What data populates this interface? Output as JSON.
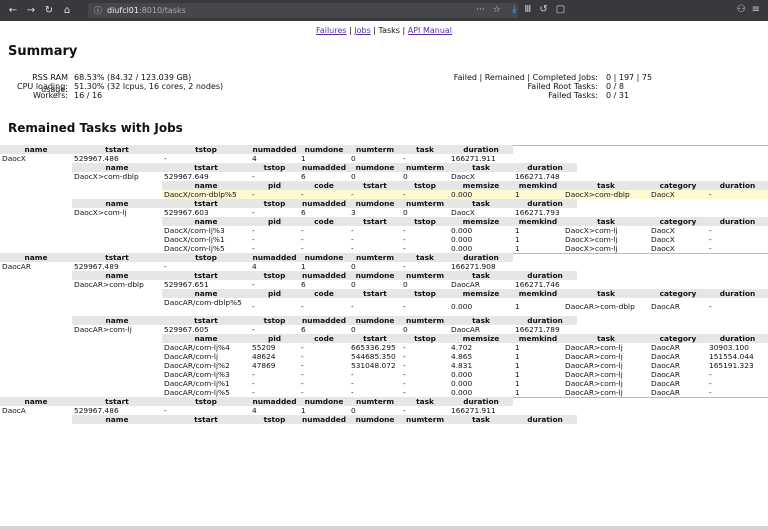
{
  "browser": {
    "host": "diufcl01",
    "path": ":8010/tasks",
    "nav_icons": [
      "←",
      "→",
      "C",
      "⌂"
    ]
  },
  "topnav": {
    "failures": "Failures",
    "jobs": "Jobs",
    "tasks": "Tasks",
    "api": "API Manual",
    "sep": " | "
  },
  "summary": {
    "title": "Summary",
    "left": [
      {
        "k": "RSS RAM usage:",
        "v": "68.53% (84.32 / 123.039 GB)"
      },
      {
        "k": "CPU loading:",
        "v": "51.30% (32 lcpus, 16 cores, 2 nodes)"
      },
      {
        "k": "Workers:",
        "v": "16 / 16"
      }
    ],
    "right": [
      {
        "k": "Failed | Remained | Completed Jobs:",
        "v": "0 | 197 | 75"
      },
      {
        "k": "Failed Root Tasks:",
        "v": "0 / 8"
      },
      {
        "k": "Failed Tasks:",
        "v": "0 / 31"
      }
    ]
  },
  "remained_title": "Remained Tasks with Jobs",
  "headers": {
    "job": [
      "name",
      "tstart",
      "tstop",
      "numadded",
      "numdone",
      "numterm",
      "task",
      "duration"
    ],
    "sub": [
      "name",
      "tstart",
      "tstop",
      "numadded",
      "numdone",
      "numterm",
      "task",
      "duration"
    ],
    "task": [
      "name",
      "pid",
      "code",
      "tstart",
      "tstop",
      "memsize",
      "memkind",
      "task",
      "category",
      "duration"
    ]
  },
  "rows": [
    {
      "t": "jh"
    },
    {
      "t": "jd",
      "v": [
        "DaocX",
        "529967.486",
        "-",
        "4",
        "1",
        "0",
        "-",
        "166271.911"
      ]
    },
    {
      "t": "sh"
    },
    {
      "t": "sd",
      "v": [
        "DaocX>com-dblp",
        "529967.649",
        "-",
        "6",
        "0",
        "0",
        "DaocX",
        "166271.748"
      ]
    },
    {
      "t": "th"
    },
    {
      "t": "td",
      "hl": true,
      "v": [
        "DaocX/com-dblp%5",
        "-",
        "-",
        "-",
        "-",
        "0.000",
        "1",
        "DaocX>com-dblp",
        "DaocX",
        "-"
      ]
    },
    {
      "t": "sh"
    },
    {
      "t": "sd",
      "v": [
        "DaocX>com-lj",
        "529967.603",
        "-",
        "6",
        "3",
        "0",
        "DaocX",
        "166271.793"
      ]
    },
    {
      "t": "th"
    },
    {
      "t": "td",
      "v": [
        "DaocX/com-lj%3",
        "-",
        "-",
        "-",
        "-",
        "0.000",
        "1",
        "DaocX>com-lj",
        "DaocX",
        "-"
      ]
    },
    {
      "t": "td",
      "v": [
        "DaocX/com-lj%1",
        "-",
        "-",
        "-",
        "-",
        "0.000",
        "1",
        "DaocX>com-lj",
        "DaocX",
        "-"
      ]
    },
    {
      "t": "td",
      "v": [
        "DaocX/com-lj%5",
        "-",
        "-",
        "-",
        "-",
        "0.000",
        "1",
        "DaocX>com-lj",
        "DaocX",
        "-"
      ]
    },
    {
      "t": "jh"
    },
    {
      "t": "jd",
      "v": [
        "DaocAR",
        "529967.489",
        "-",
        "4",
        "1",
        "0",
        "-",
        "166271.908"
      ]
    },
    {
      "t": "sh"
    },
    {
      "t": "sd",
      "v": [
        "DaocAR>com-dblp",
        "529967.651",
        "-",
        "6",
        "0",
        "0",
        "DaocAR",
        "166271.746"
      ]
    },
    {
      "t": "th"
    },
    {
      "t": "td",
      "tall": true,
      "v": [
        "DaocAR/com-dblp%5",
        "-",
        "-",
        "-",
        "-",
        "0.000",
        "1",
        "DaocAR>com-dblp",
        "DaocAR",
        "-"
      ]
    },
    {
      "t": "sh"
    },
    {
      "t": "sd",
      "v": [
        "DaocAR>com-lj",
        "529967.605",
        "-",
        "6",
        "0",
        "0",
        "DaocAR",
        "166271.789"
      ]
    },
    {
      "t": "th"
    },
    {
      "t": "td",
      "v": [
        "DaocAR/com-lj%4",
        "55209",
        "-",
        "665336.295",
        "-",
        "4.702",
        "1",
        "DaocAR>com-lj",
        "DaocAR",
        "30903.100"
      ]
    },
    {
      "t": "td",
      "v": [
        "DaocAR/com-lj",
        "48624",
        "-",
        "544685.350",
        "-",
        "4.865",
        "1",
        "DaocAR>com-lj",
        "DaocAR",
        "151554.044"
      ]
    },
    {
      "t": "td",
      "v": [
        "DaocAR/com-lj%2",
        "47869",
        "-",
        "531048.072",
        "-",
        "4.831",
        "1",
        "DaocAR>com-lj",
        "DaocAR",
        "165191.323"
      ]
    },
    {
      "t": "td",
      "v": [
        "DaocAR/com-lj%3",
        "-",
        "-",
        "-",
        "-",
        "0.000",
        "1",
        "DaocAR>com-lj",
        "DaocAR",
        "-"
      ]
    },
    {
      "t": "td",
      "v": [
        "DaocAR/com-lj%1",
        "-",
        "-",
        "-",
        "-",
        "0.000",
        "1",
        "DaocAR>com-lj",
        "DaocAR",
        "-"
      ]
    },
    {
      "t": "td",
      "v": [
        "DaocAR/com-lj%5",
        "-",
        "-",
        "-",
        "-",
        "0.000",
        "1",
        "DaocAR>com-lj",
        "DaocAR",
        "-"
      ]
    },
    {
      "t": "jh"
    },
    {
      "t": "jd",
      "v": [
        "DaocA",
        "529967.486",
        "-",
        "4",
        "1",
        "0",
        "-",
        "166271.911"
      ]
    },
    {
      "t": "sh"
    }
  ]
}
